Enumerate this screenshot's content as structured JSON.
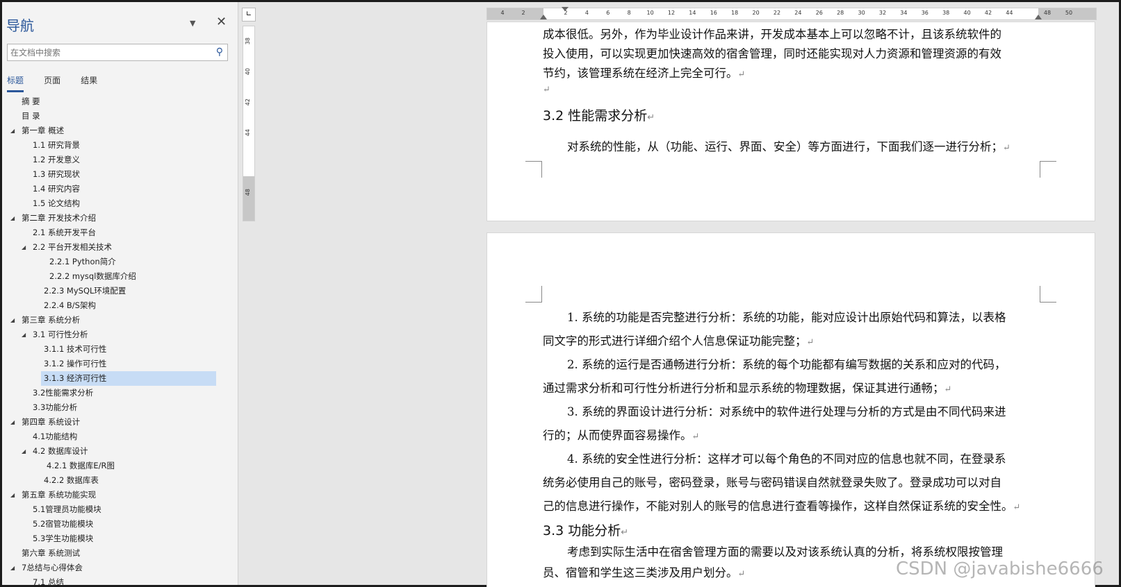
{
  "nav": {
    "title": "导航",
    "search_placeholder": "在文档中搜索",
    "tabs": [
      "标题",
      "页面",
      "结果"
    ],
    "tree": [
      {
        "label": "摘  要",
        "level": 0,
        "toggle": false
      },
      {
        "label": "目  录",
        "level": 0,
        "toggle": false
      },
      {
        "label": "第一章 概述",
        "level": 0,
        "toggle": true
      },
      {
        "label": "1.1 研究背景",
        "level": 1,
        "toggle": false
      },
      {
        "label": "1.2 开发意义",
        "level": 1,
        "toggle": false
      },
      {
        "label": "1.3 研究现状",
        "level": 1,
        "toggle": false
      },
      {
        "label": "1.4 研究内容",
        "level": 1,
        "toggle": false
      },
      {
        "label": "1.5 论文结构",
        "level": 1,
        "toggle": false
      },
      {
        "label": " 第二章 开发技术介绍",
        "level": 0,
        "toggle": true
      },
      {
        "label": "2.1 系统开发平台",
        "level": 1,
        "toggle": false
      },
      {
        "label": "2.2 平台开发相关技术",
        "level": 1,
        "toggle": true
      },
      {
        "label": "2.2.1   Python简介",
        "level": 3,
        "toggle": false
      },
      {
        "label": "2.2.2   mysql数据库介绍",
        "level": 3,
        "toggle": false
      },
      {
        "label": "2.2.3   MySQL环境配置",
        "level": 2,
        "toggle": false
      },
      {
        "label": "2.2.4   B/S架构",
        "level": 2,
        "toggle": false
      },
      {
        "label": "第三章 系统分析",
        "level": 0,
        "toggle": true
      },
      {
        "label": "3.1 可行性分析",
        "level": 1,
        "toggle": true
      },
      {
        "label": "3.1.1 技术可行性",
        "level": 2,
        "toggle": false
      },
      {
        "label": "3.1.2 操作可行性",
        "level": 2,
        "toggle": false
      },
      {
        "label": "3.1.3 经济可行性",
        "level": 2,
        "toggle": false,
        "selected": true
      },
      {
        "label": "3.2性能需求分析",
        "level": 1,
        "toggle": false
      },
      {
        "label": "3.3功能分析",
        "level": 1,
        "toggle": false
      },
      {
        "label": "第四章 系统设计",
        "level": 0,
        "toggle": true
      },
      {
        "label": "4.1功能结构",
        "level": 1,
        "toggle": false
      },
      {
        "label": "4.2 数据库设计",
        "level": 1,
        "toggle": true
      },
      {
        "label": "4.2.1 数据库E/R图",
        "level": 4,
        "toggle": false
      },
      {
        "label": "4.2.2 数据库表",
        "level": 2,
        "toggle": false
      },
      {
        "label": "第五章 系统功能实现",
        "level": 0,
        "toggle": true
      },
      {
        "label": "5.1管理员功能模块",
        "level": 1,
        "toggle": false
      },
      {
        "label": "5.2宿管功能模块",
        "level": 1,
        "toggle": false
      },
      {
        "label": "5.3学生功能模块",
        "level": 1,
        "toggle": false
      },
      {
        "label": "第六章 系统测试",
        "level": 0,
        "toggle": false
      },
      {
        "label": "7总结与心得体会",
        "level": 0,
        "toggle": true
      },
      {
        "label": "7.1 总结",
        "level": 1,
        "toggle": false
      }
    ]
  },
  "vruler_ticks": [
    "38",
    "40",
    "42",
    "44",
    "48"
  ],
  "hruler_ticks": [
    "4",
    "2",
    "2",
    "4",
    "6",
    "8",
    "10",
    "12",
    "14",
    "16",
    "18",
    "20",
    "22",
    "24",
    "26",
    "28",
    "30",
    "32",
    "34",
    "36",
    "38",
    "40",
    "42",
    "44",
    "48",
    "50"
  ],
  "page1": {
    "lines": [
      "成本很低。另外，作为毕业设计作品来讲，开发成本基本上可以忽略不计，且该系统软件的",
      "投入使用，可以实现更加快速高效的宿舍管理，同时还能实现对人力资源和管理资源的有效",
      "节约，该管理系统在经济上完全可行。"
    ],
    "heading": "3.2 性能需求分析",
    "para": "对系统的性能，从（功能、运行、界面、安全）等方面进行，下面我们逐一进行分析；"
  },
  "page2": {
    "items": [
      [
        "1.  系统的功能是否完整进行分析：系统的功能，能对应设计出原始代码和算法，以表格",
        "同文字的形式进行详细介绍个人信息保证功能完整；"
      ],
      [
        "2.  系统的运行是否通畅进行分析：系统的每个功能都有编写数据的关系和应对的代码，",
        "通过需求分析和可行性分析进行分析和显示系统的物理数据，保证其进行通畅；"
      ],
      [
        "3.  系统的界面设计进行分析：对系统中的软件进行处理与分析的方式是由不同代码来进",
        "行的；从而使界面容易操作。"
      ],
      [
        "4.  系统的安全性进行分析：这样才可以每个角色的不同对应的信息也就不同，在登录系",
        "统务必使用自己的账号，密码登录，账号与密码错误自然就登录失败了。登录成功可以对自",
        "己的信息进行操作，不能对别人的账号的信息进行查看等操作，这样自然保证系统的安全性。"
      ]
    ],
    "heading": "3.3 功能分析",
    "para": [
      "考虑到实际生活中在宿舍管理方面的需要以及对该系统认真的分析，将系统权限按管理",
      "员、宿管和学生这三类涉及用户划分。"
    ]
  },
  "watermark": "CSDN @javabishe6666",
  "return_mark": "↵"
}
